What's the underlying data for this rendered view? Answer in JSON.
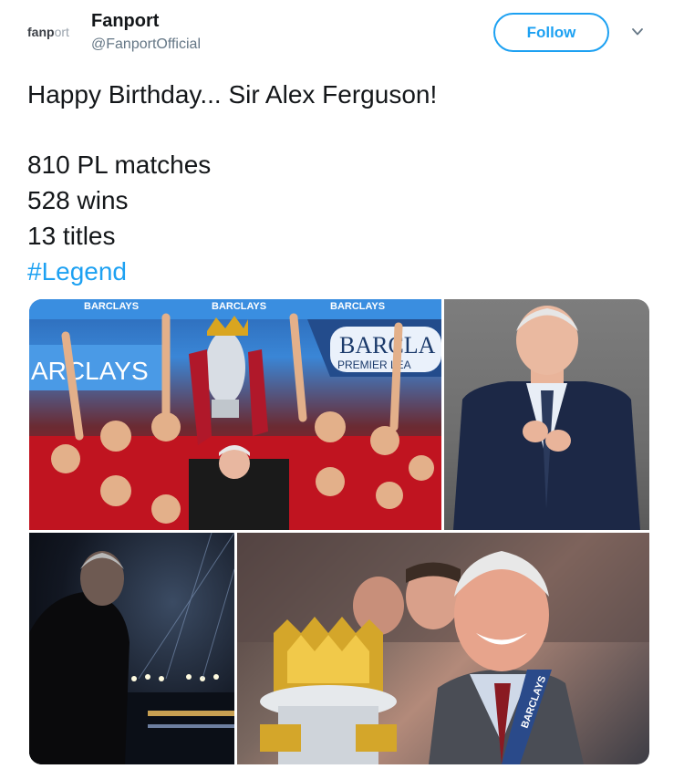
{
  "account": {
    "avatar_logo_a": "fanp",
    "avatar_logo_b": "o",
    "avatar_logo_c": "rt",
    "name": "Fanport",
    "handle": "@FanportOfficial"
  },
  "actions": {
    "follow_label": "Follow"
  },
  "tweet": {
    "line1": "Happy Birthday... Sir Alex Ferguson!",
    "line2": "810 PL matches",
    "line3": "528 wins",
    "line4": "13 titles",
    "hashtag": "#Legend"
  },
  "photo1": {
    "banner_text": "BARCLAYS",
    "board_left": "ARCLAYS",
    "board_right_top": "BARCLA",
    "board_right_bottom": "PREMIER LEA"
  },
  "photo4": {
    "sash_text": "BARCLAYS"
  },
  "colors": {
    "accent": "#1da1f2",
    "text": "#14171a",
    "secondary": "#657786"
  }
}
